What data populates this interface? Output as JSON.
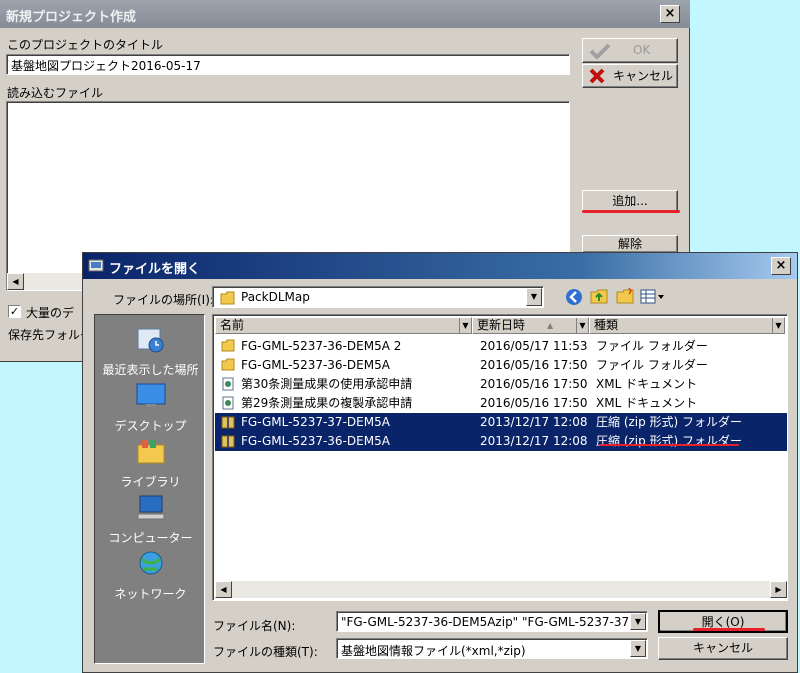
{
  "project_dialog": {
    "title": "新規プロジェクト作成",
    "close": "×",
    "title_label": "このプロジェクトのタイトル",
    "title_value": "基盤地図プロジェクト2016-05-17",
    "files_label": "読み込むファイル",
    "ok_label": "OK",
    "cancel_label": "キャンセル",
    "add_label": "追加...",
    "remove_label": "解除",
    "bulk_label": "大量のデ",
    "save_label": "保存先フォルダ",
    "bulk_checked": "✓"
  },
  "open_dialog": {
    "title": "ファイルを開く",
    "close": "×",
    "location_label": "ファイルの場所(I):",
    "location_value": "PackDLMap",
    "places": [
      {
        "label": "最近表示した場所",
        "icon": "recent-places-icon"
      },
      {
        "label": "デスクトップ",
        "icon": "desktop-icon"
      },
      {
        "label": "ライブラリ",
        "icon": "libraries-icon"
      },
      {
        "label": "コンピューター",
        "icon": "computer-icon"
      },
      {
        "label": "ネットワーク",
        "icon": "network-icon"
      }
    ],
    "columns": [
      "名前",
      "更新日時",
      "種類"
    ],
    "files": [
      {
        "name": "FG-GML-5237-36-DEM5A 2",
        "date": "2016/05/17 11:53",
        "type": "ファイル フォルダー",
        "icon": "folder-icon",
        "selected": false
      },
      {
        "name": "FG-GML-5237-36-DEM5A",
        "date": "2016/05/16 17:50",
        "type": "ファイル フォルダー",
        "icon": "folder-icon",
        "selected": false
      },
      {
        "name": "第30条測量成果の使用承認申請",
        "date": "2016/05/16 17:50",
        "type": "XML ドキュメント",
        "icon": "xml-document-icon",
        "selected": false
      },
      {
        "name": "第29条測量成果の複製承認申請",
        "date": "2016/05/16 17:50",
        "type": "XML ドキュメント",
        "icon": "xml-document-icon",
        "selected": false
      },
      {
        "name": "FG-GML-5237-37-DEM5A",
        "date": "2013/12/17 12:08",
        "type": "圧縮 (zip 形式) フォルダー",
        "icon": "zip-folder-icon",
        "selected": true
      },
      {
        "name": "FG-GML-5237-36-DEM5A",
        "date": "2013/12/17 12:08",
        "type": "圧縮 (zip 形式) フォルダー",
        "icon": "zip-folder-icon",
        "selected": true
      }
    ],
    "filename_label": "ファイル名(N):",
    "filename_value": "\"FG-GML-5237-36-DEM5Azip\" \"FG-GML-5237-37",
    "filetype_label": "ファイルの種類(T):",
    "filetype_value": "基盤地図情報ファイル(*xml,*zip)",
    "open_label": "開く(O)",
    "cancel_label": "キャンセル"
  },
  "colors": {
    "selection": "#0a246a",
    "annotation": "#e8202a",
    "desktop": "#c2f7ff"
  }
}
